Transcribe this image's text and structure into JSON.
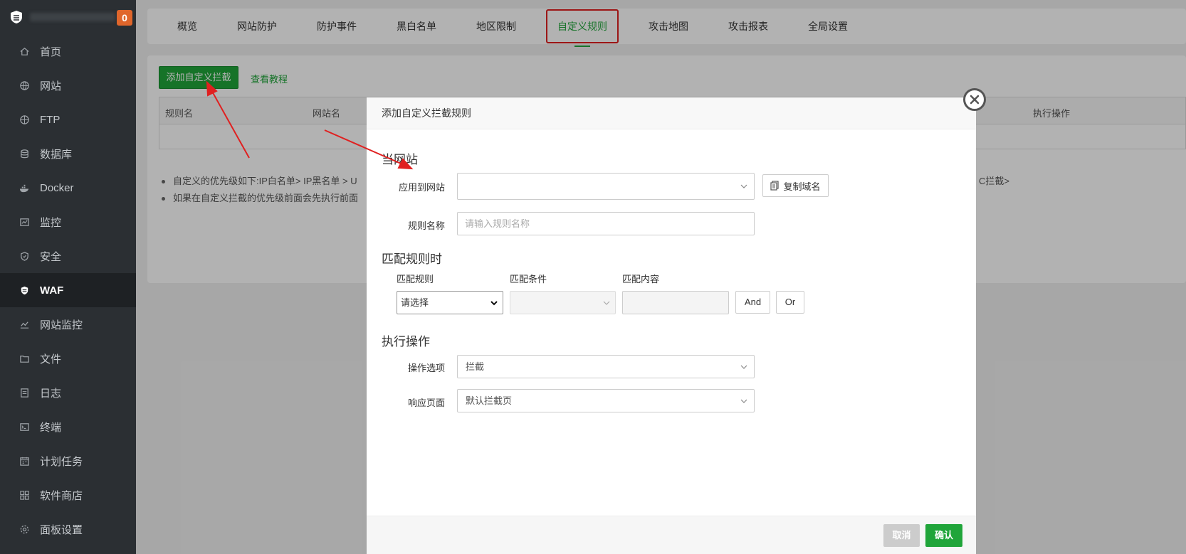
{
  "sidebar": {
    "badge": "0",
    "items": [
      {
        "label": "首页",
        "icon": "home-icon"
      },
      {
        "label": "网站",
        "icon": "globe-icon"
      },
      {
        "label": "FTP",
        "icon": "ftp-icon"
      },
      {
        "label": "数据库",
        "icon": "database-icon"
      },
      {
        "label": "Docker",
        "icon": "docker-icon"
      },
      {
        "label": "监控",
        "icon": "monitor-icon"
      },
      {
        "label": "安全",
        "icon": "shield-icon"
      },
      {
        "label": "WAF",
        "icon": "waf-icon"
      },
      {
        "label": "网站监控",
        "icon": "site-monitor-icon"
      },
      {
        "label": "文件",
        "icon": "folder-icon"
      },
      {
        "label": "日志",
        "icon": "log-icon"
      },
      {
        "label": "终端",
        "icon": "terminal-icon"
      },
      {
        "label": "计划任务",
        "icon": "calendar-icon"
      },
      {
        "label": "软件商店",
        "icon": "apps-icon"
      },
      {
        "label": "面板设置",
        "icon": "gear-icon"
      }
    ],
    "active": "WAF"
  },
  "tabs": [
    "概览",
    "网站防护",
    "防护事件",
    "黑白名单",
    "地区限制",
    "自定义规则",
    "攻击地图",
    "攻击报表",
    "全局设置"
  ],
  "active_tab": "自定义规则",
  "panel": {
    "add_button": "添加自定义拦截",
    "tutorial_link": "查看教程",
    "columns": {
      "rule_name": "规则名",
      "site_name": "网站名",
      "action": "执行操作"
    },
    "notes": [
      "自定义的优先级如下:IP白名单> IP黑名单 > U",
      "如果在自定义拦截的优先级前面会先执行前面"
    ],
    "notes_tail": "C拦截>"
  },
  "modal": {
    "title": "添加自定义拦截规则",
    "section_site": "当网站",
    "apply_label": "应用到网站",
    "apply_value": "",
    "copy_domain": "复制域名",
    "rule_name_label": "规则名称",
    "rule_name_placeholder": "请输入规则名称",
    "section_match": "匹配规则时",
    "match_rule_label": "匹配规则",
    "match_cond_label": "匹配条件",
    "match_content_label": "匹配内容",
    "match_rule_value": "请选择",
    "and_button": "And",
    "or_button": "Or",
    "section_action": "执行操作",
    "action_option_label": "操作选项",
    "action_option_value": "拦截",
    "response_page_label": "响应页面",
    "response_page_value": "默认拦截页",
    "cancel": "取消",
    "confirm": "确认"
  },
  "colors": {
    "accent": "#20a53a",
    "annotation": "#e02020",
    "sidebar": "#2b2f33"
  }
}
